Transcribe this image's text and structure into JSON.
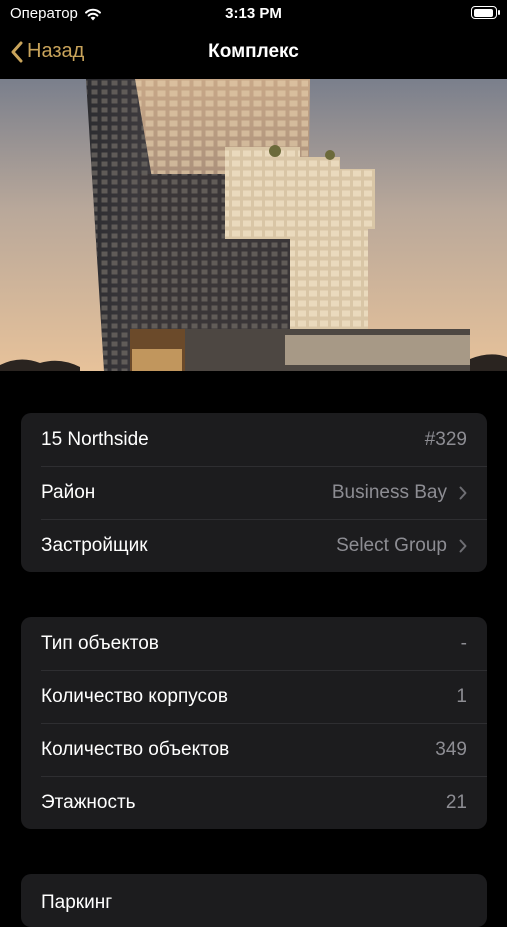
{
  "status": {
    "carrier": "Оператор",
    "time": "3:13 PM",
    "battery_level": 1.0
  },
  "nav": {
    "back_label": "Назад",
    "title": "Комплекс"
  },
  "colors": {
    "accent": "#c9a45b",
    "background": "#000000",
    "card": "#1c1c1e",
    "secondary_text": "#8d8d93"
  },
  "group1": {
    "rows": [
      {
        "label": "15 Northside",
        "value": "#329"
      },
      {
        "label": "Район",
        "value": "Business Bay"
      },
      {
        "label": "Застройщик",
        "value": "Select Group"
      }
    ]
  },
  "group2": {
    "rows": [
      {
        "label": "Тип объектов",
        "value": "-"
      },
      {
        "label": "Количество корпусов",
        "value": "1"
      },
      {
        "label": "Количество объектов",
        "value": "349"
      },
      {
        "label": "Этажность",
        "value": "21"
      }
    ]
  },
  "group3": {
    "rows": [
      {
        "label": "Паркинг",
        "value": ""
      }
    ]
  }
}
